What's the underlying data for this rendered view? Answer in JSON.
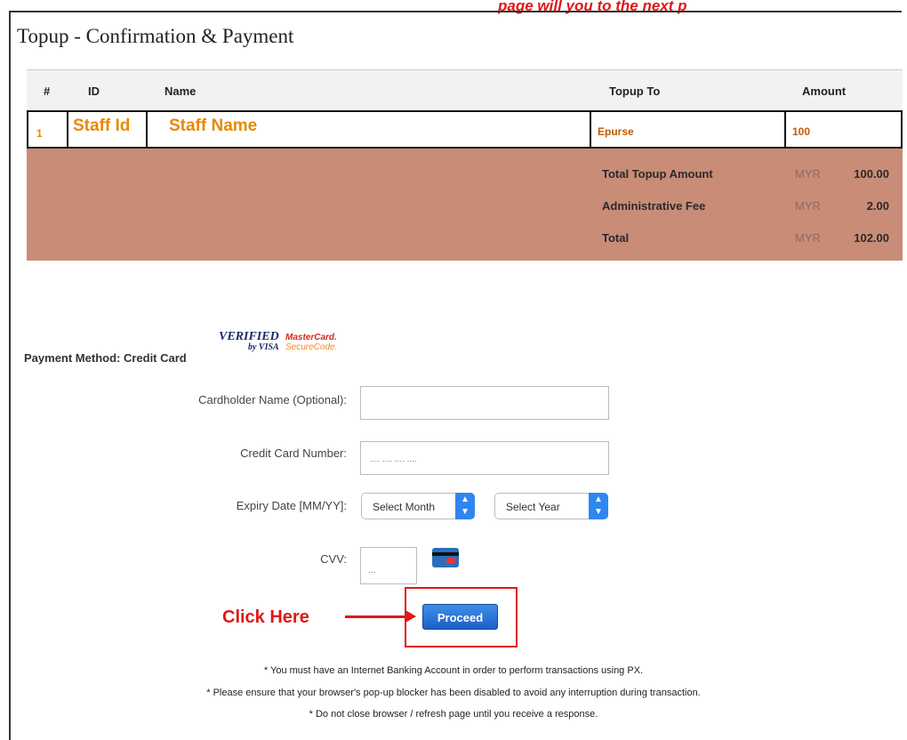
{
  "caption": "page will you to the next p",
  "page_title": "Topup - Confirmation & Payment",
  "table": {
    "headers": {
      "num": "#",
      "id": "ID",
      "name": "Name",
      "topup_to": "Topup To",
      "amount": "Amount"
    },
    "row": {
      "num": "1",
      "id": "Staff Id",
      "name": "Staff Name",
      "topup_to": "Epurse",
      "amount": "100"
    }
  },
  "summary": [
    {
      "label": "Total Topup Amount",
      "currency": "MYR",
      "value": "100.00"
    },
    {
      "label": "Administrative Fee",
      "currency": "MYR",
      "value": "2.00"
    },
    {
      "label": "Total",
      "currency": "MYR",
      "value": "102.00"
    }
  ],
  "payment": {
    "method_label": "Payment Method: Credit Card",
    "verified_line1": "VERIFIED",
    "verified_line2": "by VISA",
    "mastercard_line1": "MasterCard.",
    "mastercard_line2": "SecureCode."
  },
  "form": {
    "cardholder_label": "Cardholder Name (Optional):",
    "card_number_label": "Credit Card Number:",
    "card_number_value": ".... .... .... ....",
    "expiry_label": "Expiry Date [MM/YY]:",
    "month_value": "Select Month",
    "year_value": "Select Year",
    "cvv_label": "CVV:",
    "cvv_value": "..."
  },
  "click_here": "Click Here",
  "proceed_label": "Proceed",
  "notes": [
    "* You must have an Internet Banking Account in order to perform transactions using PX.",
    "* Please ensure that your browser's pop-up blocker has been disabled to avoid any interruption during transaction.",
    "* Do not close browser / refresh page until you receive a response."
  ]
}
